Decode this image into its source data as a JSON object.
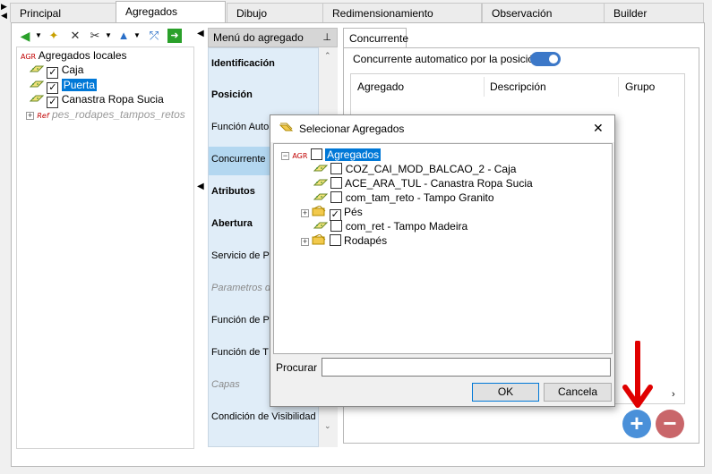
{
  "tabs": [
    "Principal",
    "Agregados",
    "Dibujo",
    "Redimensionamiento",
    "Observación",
    "Builder"
  ],
  "active_tab": "Agregados",
  "left_tree": {
    "root_tag": "AGR",
    "root_label": "Agregados locales",
    "items": [
      {
        "label": "Caja",
        "checked": true,
        "selected": false
      },
      {
        "label": "Puerta",
        "checked": true,
        "selected": true
      },
      {
        "label": "Canastra Ropa Sucia",
        "checked": true,
        "selected": false
      }
    ],
    "ref_tag": "Ref",
    "ref_label": "pes_rodapes_tampos_retos"
  },
  "menu": {
    "header": "Menú do agregado",
    "pin": "ᵖ",
    "items": [
      {
        "label": "Identificación",
        "style": "bold"
      },
      {
        "label": "Posición",
        "style": "bold"
      },
      {
        "label": "Función Auto",
        "style": "normal"
      },
      {
        "label": "Concurrente",
        "style": "normal"
      },
      {
        "label": "Atributos",
        "style": "bold"
      },
      {
        "label": "Abertura",
        "style": "bold"
      },
      {
        "label": "Servicio de P",
        "style": "normal"
      },
      {
        "label": "Parametros d",
        "style": "italic"
      },
      {
        "label": "Función de P",
        "style": "normal"
      },
      {
        "label": "Función de T",
        "style": "normal"
      },
      {
        "label": "Capas",
        "style": "italic"
      },
      {
        "label": "Condición de Visibilidad",
        "style": "normal"
      }
    ],
    "selected": "Concurrente"
  },
  "right": {
    "tab_label": "Concurrente",
    "toggle_label": "Concurrente automatico por la posición",
    "toggle_on": true,
    "columns": [
      "Agregado",
      "Descripción",
      "Grupo"
    ]
  },
  "dialog": {
    "title": "Selecionar Agregados",
    "close": "✕",
    "root_tag": "AGR",
    "root_label": "Agregados",
    "items": [
      {
        "label": "COZ_CAI_MOD_BALCAO_2 - Caja",
        "checked": false,
        "type": "agg",
        "expandable": false
      },
      {
        "label": "ACE_ARA_TUL - Canastra Ropa Sucia",
        "checked": false,
        "type": "agg",
        "expandable": false
      },
      {
        "label": "com_tam_reto - Tampo Granito",
        "checked": false,
        "type": "agg",
        "expandable": false
      },
      {
        "label": "Pés",
        "checked": true,
        "type": "folder",
        "expandable": true
      },
      {
        "label": "com_ret - Tampo Madeira",
        "checked": false,
        "type": "agg",
        "expandable": false
      },
      {
        "label": "Rodapés",
        "checked": false,
        "type": "folder",
        "expandable": true
      }
    ],
    "search_label": "Procurar",
    "search_value": "",
    "ok_label": "OK",
    "cancel_label": "Cancela"
  },
  "colors": {
    "accent": "#3c78c8",
    "add_button": "#4a90d9",
    "remove_button": "#c9666a",
    "arrow": "#e00000"
  }
}
